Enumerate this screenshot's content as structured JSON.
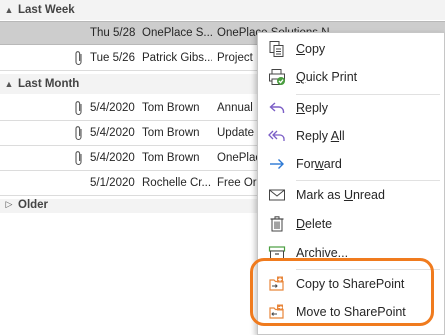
{
  "groups": {
    "last_week": {
      "label": "Last Week",
      "chevron": "▲"
    },
    "last_month": {
      "label": "Last Month",
      "chevron": "▲"
    },
    "older": {
      "label": "Older",
      "chevron": "▷"
    }
  },
  "rows": [
    {
      "date": "Thu 5/28",
      "from": "OnePlace S...",
      "subject": "OnePlace Solutions N",
      "attachment": false,
      "selected": true
    },
    {
      "date": "Tue 5/26",
      "from": "Patrick Gibs...",
      "subject": "Project",
      "attachment": true,
      "selected": false
    },
    {
      "date": "5/4/2020",
      "from": "Tom Brown",
      "subject": "Annual",
      "attachment": true,
      "selected": false
    },
    {
      "date": "5/4/2020",
      "from": "Tom Brown",
      "subject": "Update",
      "attachment": true,
      "selected": false
    },
    {
      "date": "5/4/2020",
      "from": "Tom Brown",
      "subject": "OnePlac",
      "attachment": true,
      "selected": false
    },
    {
      "date": "5/1/2020",
      "from": "Rochelle Cr...",
      "subject": "Free Or",
      "attachment": false,
      "selected": false
    }
  ],
  "menu": {
    "copy": {
      "pre": "",
      "key": "C",
      "post": "opy",
      "icon": "copy-icon"
    },
    "quick_print": {
      "pre": "",
      "key": "Q",
      "post": "uick Print",
      "icon": "quick-print-icon"
    },
    "reply": {
      "pre": "",
      "key": "R",
      "post": "eply",
      "icon": "reply-icon"
    },
    "reply_all": {
      "pre": "Reply ",
      "key": "A",
      "post": "ll",
      "icon": "reply-all-icon"
    },
    "forward": {
      "pre": "For",
      "key": "w",
      "post": "ard",
      "icon": "forward-icon"
    },
    "mark_unread": {
      "pre": "Mark as ",
      "key": "U",
      "post": "nread",
      "icon": "envelope-icon"
    },
    "delete": {
      "pre": "",
      "key": "D",
      "post": "elete",
      "icon": "trash-icon"
    },
    "archive": {
      "pre": "",
      "key": "A",
      "post": "rchive...",
      "icon": "archive-icon"
    },
    "copy_sharepoint": {
      "label": "Copy to SharePoint",
      "icon": "copy-to-sharepoint-icon"
    },
    "move_sharepoint": {
      "label": "Move to SharePoint",
      "icon": "move-to-sharepoint-icon"
    }
  },
  "colors": {
    "accent_purple": "#7b5ec6",
    "accent_blue": "#2b78d4",
    "accent_green": "#4a9e3f",
    "sharepoint_orange": "#e8863a",
    "highlight_ring": "#f07b1e"
  }
}
